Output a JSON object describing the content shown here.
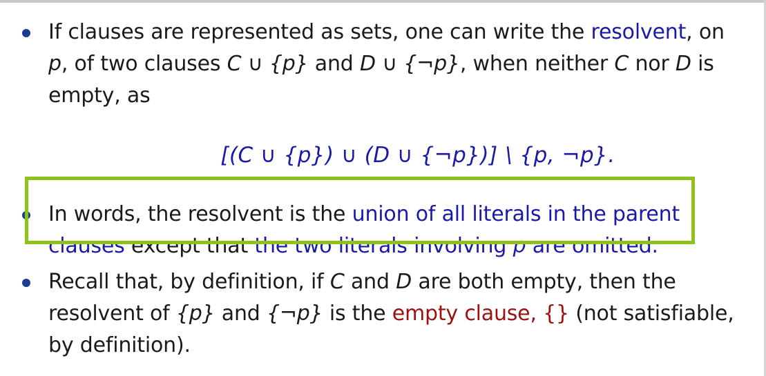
{
  "bullet1": {
    "t1": "If clauses are represented as sets, one can write the ",
    "resolvent": "resolvent",
    "t2": ", on ",
    "p": "p",
    "t3": ", of two clauses ",
    "cup_p": "C ∪ {p}",
    "t4": " and ",
    "dup_np": "D ∪ {¬p}",
    "t5": ", when neither ",
    "C": "C",
    "t6": " nor ",
    "D": "D",
    "t7": " is empty, as"
  },
  "equation": "[(C ∪ {p}) ∪ (D ∪ {¬p})] \\ {p, ¬p}.",
  "bullet2": {
    "t1": "In words, the resolvent is the ",
    "union": "union of all literals in the parent clauses",
    "t2": " except that ",
    "omitted_a": "the two literals involving ",
    "p": "p",
    "omitted_b": " are omitted",
    "t3": "."
  },
  "bullet3": {
    "t1": "Recall that, by definition, if ",
    "C": "C",
    "t2": " and ",
    "D": "D",
    "t3": " are both empty, then the resolvent of ",
    "set_p": "{p}",
    "t4": " and ",
    "set_np": "{¬p}",
    "t5": " is the ",
    "empty_clause": "empty clause,",
    "t6": " ",
    "braces": "{}",
    "t7": " (not satisfiable, by definition)."
  },
  "colors": {
    "blue_text": "#1a1aa6",
    "red_text": "#9b1010",
    "highlight_border": "#8cc21a",
    "bullet_dot": "#1a3d8f"
  }
}
